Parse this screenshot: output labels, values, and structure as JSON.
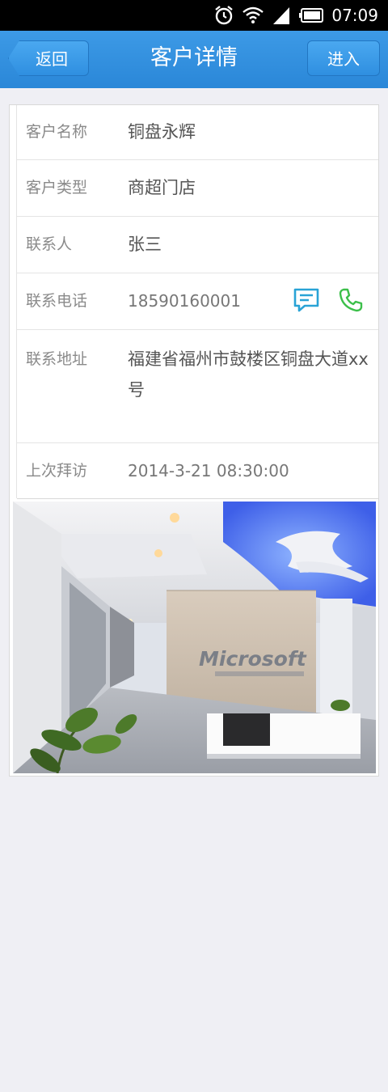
{
  "status_bar": {
    "time": "07:09"
  },
  "nav": {
    "back_label": "返回",
    "title": "客户详情",
    "enter_label": "进入"
  },
  "customer": {
    "name_label": "客户名称",
    "name_value": "铜盘永辉",
    "type_label": "客户类型",
    "type_value": "商超门店",
    "contact_label": "联系人",
    "contact_value": "张三",
    "phone_label": "联系电话",
    "phone_value": "18590160001",
    "address_label": "联系地址",
    "address_value": "福建省福州市鼓楼区铜盘大道xx号",
    "last_visit_label": "上次拜访",
    "last_visit_value": "2014-3-21  08:30:00"
  },
  "photo": {
    "logo_text": "Microsoft"
  },
  "colors": {
    "nav_blue": "#2a87d8",
    "sms_icon": "#29a3d6",
    "call_icon": "#3cbf4a"
  },
  "icons": [
    "alarm-icon",
    "wifi-icon",
    "signal-icon",
    "battery-icon",
    "sms-icon",
    "phone-icon",
    "back-arrow-icon"
  ]
}
